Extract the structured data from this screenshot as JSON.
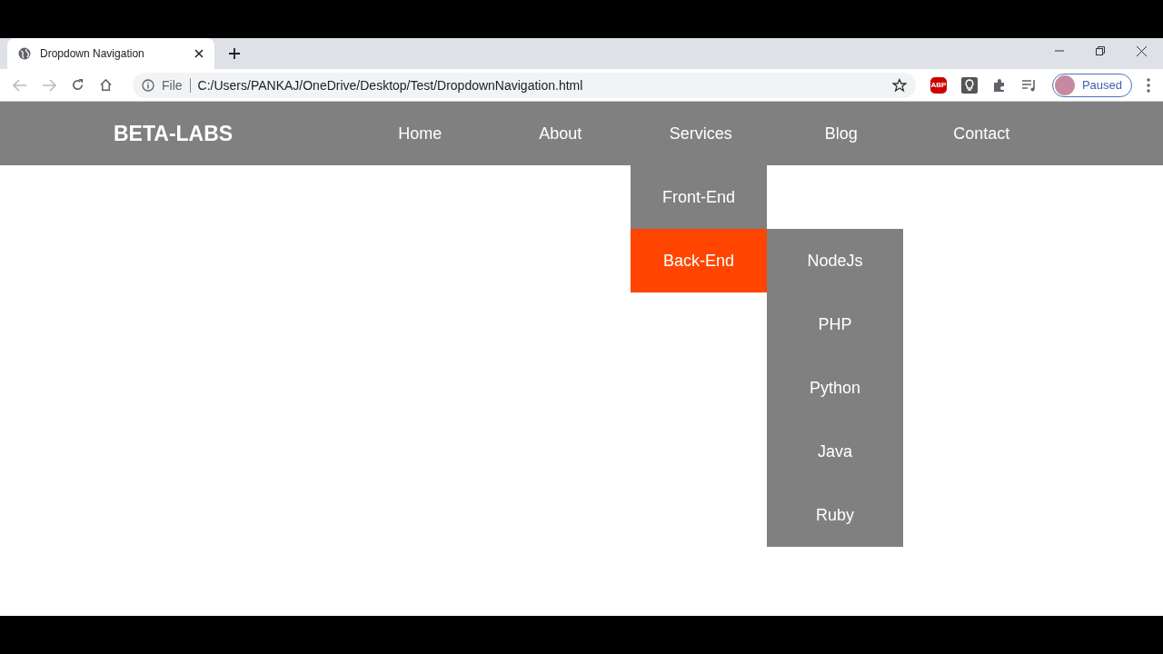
{
  "browser": {
    "tab_title": "Dropdown Navigation",
    "address_scheme": "File",
    "address": "C:/Users/PANKAJ/OneDrive/Desktop/Test/DropdownNavigation.html",
    "extension_label": "ABP",
    "profile_status": "Paused"
  },
  "site": {
    "logo": "BETA-LABS",
    "nav": [
      {
        "label": "Home"
      },
      {
        "label": "About"
      },
      {
        "label": "Services",
        "expanded": true,
        "children": [
          {
            "label": "Front-End",
            "selected": false
          },
          {
            "label": "Back-End",
            "selected": true,
            "expanded": true,
            "children": [
              {
                "label": "NodeJs"
              },
              {
                "label": "PHP"
              },
              {
                "label": "Python"
              },
              {
                "label": "Java"
              },
              {
                "label": "Ruby"
              }
            ]
          }
        ]
      },
      {
        "label": "Blog"
      },
      {
        "label": "Contact"
      }
    ]
  }
}
